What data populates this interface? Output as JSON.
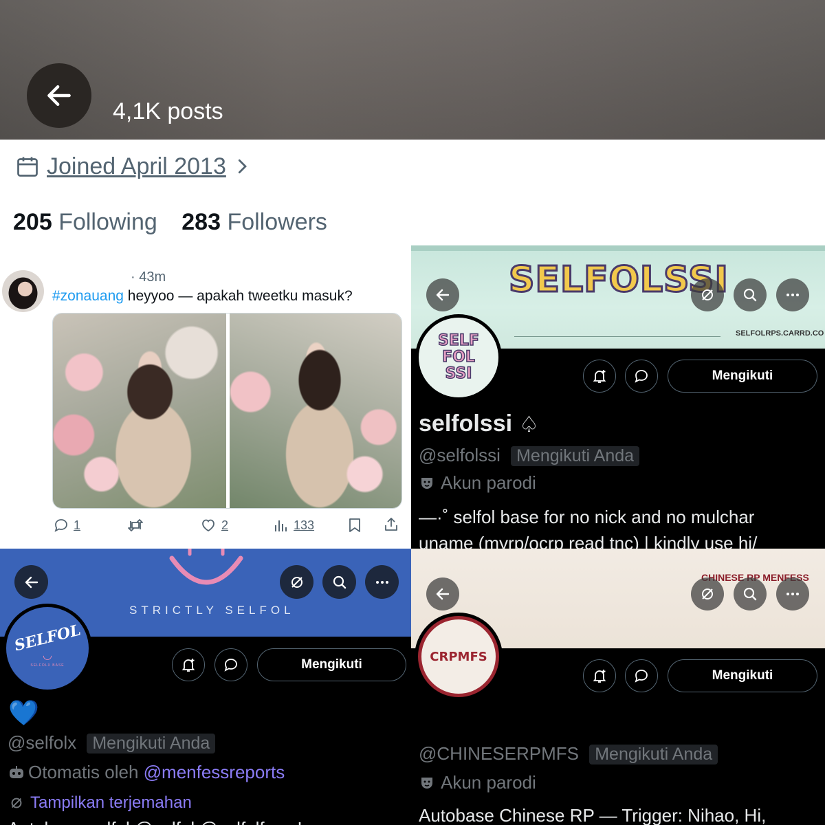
{
  "top_profile": {
    "post_count": "4,1K posts",
    "joined": "Joined April 2013",
    "following_count": "205",
    "following_label": "Following",
    "followers_count": "283",
    "followers_label": "Followers"
  },
  "tweet": {
    "time": "· 43m",
    "hashtag": "#zonauang",
    "text": " heyyoo — apakah tweetku masuk?",
    "reply_count": "1",
    "like_count": "2",
    "view_count": "133"
  },
  "selfolssi": {
    "banner_title": "SELFOLSSI",
    "banner_url": "SELFOLRPS.CARRD.CO",
    "avatar_text": "SELF FOL SSI",
    "follow_label": "Mengikuti",
    "display_name": "selfolssi",
    "name_suffix": "♤",
    "handle": "@selfolssi",
    "follows_you": "Mengikuti Anda",
    "badge_label": "Akun parodi",
    "bio_line1": "—·˚ selfol base for no nick and no mulchar",
    "bio_line2": "uname (myrp/ocrp read tnc) | kindly use hi/"
  },
  "selfolx": {
    "banner_title": "STRICTLY SELFOL",
    "avatar_text": "SELFOL",
    "avatar_subtext": "SELFOLX BASE",
    "follow_label": "Mengikuti",
    "display_name": "💙",
    "handle": "@selfolx",
    "follows_you": "Mengikuti Anda",
    "automated_prefix": "Otomatis oleh ",
    "automated_by": "@menfessreports",
    "translate_label": "Tampilkan terjemahan",
    "bio_partial": "Autobase selfol @selfol @selfolfess !"
  },
  "crpmfs": {
    "banner_title": "CHINESE RP MENFESS",
    "avatar_text": "CRPMFS",
    "follow_label": "Mengikuti",
    "handle": "@CHINESERPMFS",
    "follows_you": "Mengikuti Anda",
    "badge_label": "Akun parodi",
    "bio_line1": "Autobase Chinese RP — Trigger: Nihao, Hi,"
  },
  "colors": {
    "link_blue": "#1d9bf0",
    "purple_link": "#8b7cf6",
    "banner_blue": "#3a63b8",
    "dark_text": "#0f1419",
    "muted": "#71767b"
  },
  "icons": [
    "back-arrow-icon",
    "calendar-icon",
    "chevron-right-icon",
    "reply-icon",
    "retweet-icon",
    "like-icon",
    "views-icon",
    "bookmark-icon",
    "share-icon",
    "search-icon",
    "more-icon",
    "translate-icon",
    "notify-icon",
    "message-icon",
    "parody-mask-icon",
    "robot-icon"
  ]
}
